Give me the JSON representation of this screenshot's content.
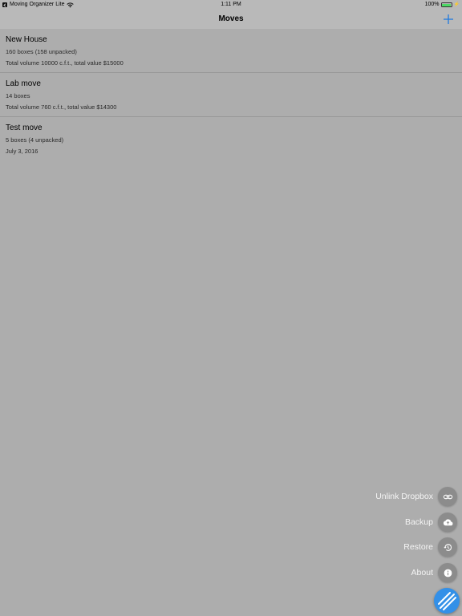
{
  "status_bar": {
    "app_back_label": "Moving Organizer Lite",
    "time": "1:11 PM",
    "battery": "100%",
    "battery_level": 1.0
  },
  "nav": {
    "title": "Moves",
    "add_icon": "plus-icon"
  },
  "moves": [
    {
      "name": "New House",
      "line1": "160 boxes (158 unpacked)",
      "line2": "Total volume 10000 c.f.t., total value $15000"
    },
    {
      "name": "Lab move",
      "line1": "14 boxes",
      "line2": "Total volume 760 c.f.t., total value $14300"
    },
    {
      "name": "Test move",
      "line1": "5 boxes (4 unpacked)",
      "line2": "July 3, 2016"
    }
  ],
  "fab_menu": {
    "items": [
      {
        "label": "Unlink Dropbox",
        "icon": "link-icon"
      },
      {
        "label": "Backup",
        "icon": "cloud-upload-icon"
      },
      {
        "label": "Restore",
        "icon": "history-icon"
      },
      {
        "label": "About",
        "icon": "info-icon"
      }
    ],
    "main_icon": "stripes-icon"
  },
  "colors": {
    "accent": "#3390e8",
    "add_icon": "#1f7ae0",
    "mini_fab": "#8c8c8c",
    "battery": "#4cd964"
  }
}
